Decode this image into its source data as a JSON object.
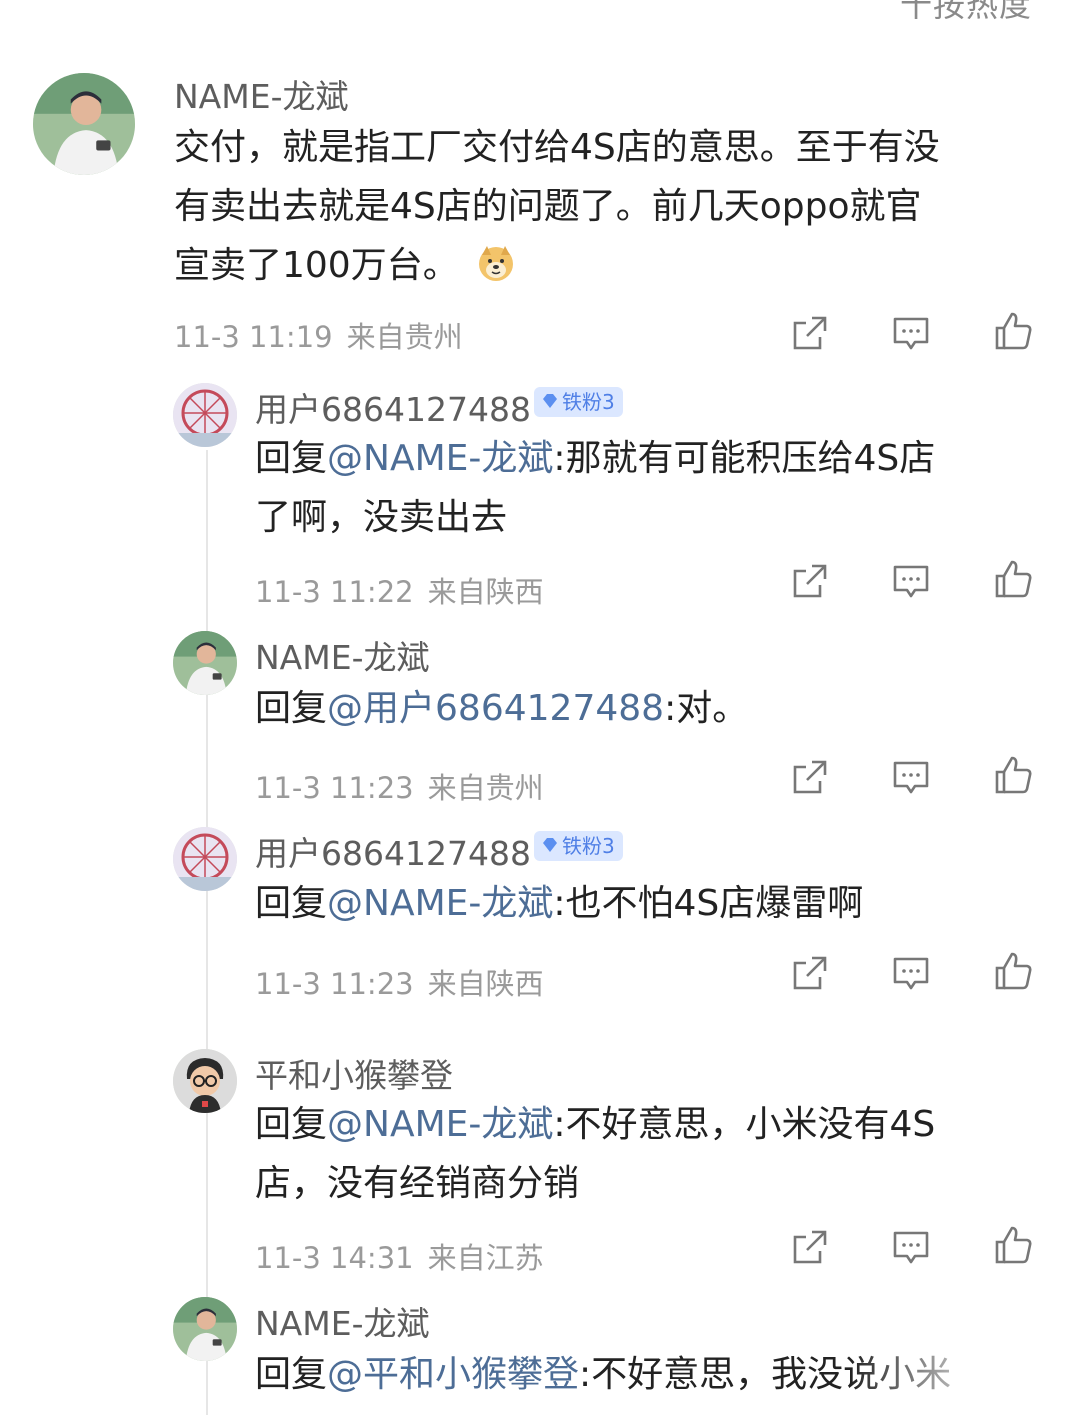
{
  "top_cut_text": "十按热度",
  "main_comment": {
    "name": "NAME-龙斌",
    "text": "交付，就是指工厂交付给4S店的意思。至于有没有卖出去就是4S店的问题了。前几天oppo就官宣卖了100万台。",
    "lines": [
      "交付，就是指工厂交付给4S店的意思。至于有没",
      "有卖出去就是4S店的问题了。前几天oppo就官",
      "宣卖了100万台。"
    ],
    "emoji": "doge-emoji",
    "time": "11-3 11:19",
    "location": "来自贵州"
  },
  "replies": [
    {
      "name": "用户6864127488",
      "badge": "铁粉3",
      "reply_prefix": "回复",
      "mention": "@NAME-龙斌",
      "lines": [
        ":那就有可能积压给4S店",
        "了啊，没卖出去"
      ],
      "time": "11-3 11:22",
      "location": "来自陕西"
    },
    {
      "name": "NAME-龙斌",
      "badge": "",
      "reply_prefix": "回复",
      "mention": "@用户6864127488",
      "lines": [
        ":对。"
      ],
      "time": "11-3 11:23",
      "location": "来自贵州"
    },
    {
      "name": "用户6864127488",
      "badge": "铁粉3",
      "reply_prefix": "回复",
      "mention": "@NAME-龙斌",
      "lines": [
        ":也不怕4S店爆雷啊"
      ],
      "time": "11-3 11:23",
      "location": "来自陕西"
    },
    {
      "name": "平和小猴攀登",
      "badge": "",
      "reply_prefix": "回复",
      "mention": "@NAME-龙斌",
      "lines": [
        ":不好意思，小米没有4S",
        "店，没有经销商分销"
      ],
      "time": "11-3 14:31",
      "location": "来自江苏"
    },
    {
      "name": "NAME-龙斌",
      "badge": "",
      "reply_prefix": "回复",
      "mention": "@平和小猴攀登",
      "lines": [
        ":不好意思，我没说小米"
      ],
      "time": "",
      "location": ""
    }
  ],
  "icons": [
    "share-icon",
    "comment-icon",
    "like-icon"
  ],
  "colors": {
    "mention": "#4d6d96",
    "meta": "#9a9a9a",
    "badge_bg": "#dbe7ff",
    "badge_text": "#4f7fe6"
  }
}
